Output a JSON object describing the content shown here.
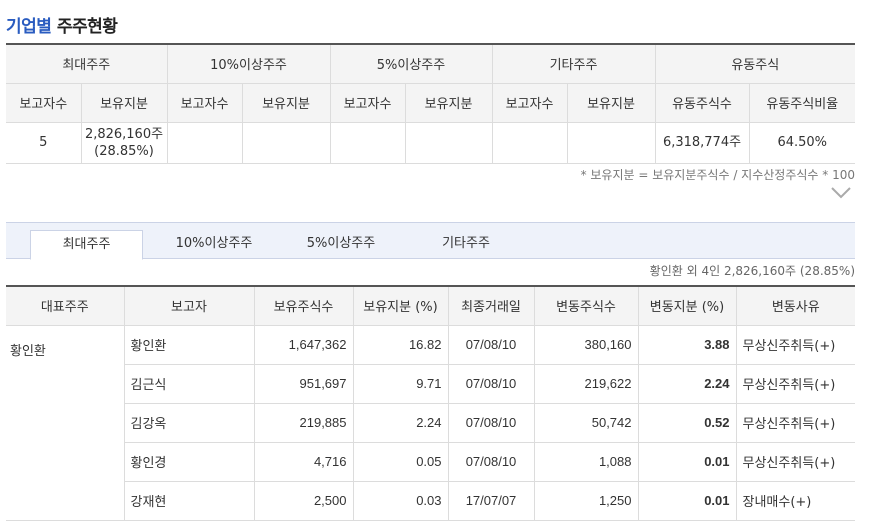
{
  "title": {
    "accent": "기업별",
    "rest": "주주현황"
  },
  "summary": {
    "groups": [
      "최대주주",
      "10%이상주주",
      "5%이상주주",
      "기타주주",
      "유동주식"
    ],
    "subheaders": [
      "보고자수",
      "보유지분",
      "보고자수",
      "보유지분",
      "보고자수",
      "보유지분",
      "보고자수",
      "보유지분",
      "유동주식수",
      "유동주식비율"
    ],
    "row": {
      "reporters": "5",
      "holding_line1": "2,826,160주",
      "holding_line2": "(28.85%)",
      "c3": "",
      "c4": "",
      "c5": "",
      "c6": "",
      "c7": "",
      "c8": "",
      "float_shares": "6,318,774주",
      "float_ratio": "64.50%"
    }
  },
  "footnote": "* 보유지분 = 보유지분주식수 / 지수산정주식수 * 100",
  "tabs": [
    "최대주주",
    "10%이상주주",
    "5%이상주주",
    "기타주주"
  ],
  "active_tab": 0,
  "owner_summary": "황인환 외 4인 2,826,160주 (28.85%)",
  "detail": {
    "headers": [
      "대표주주",
      "보고자",
      "보유주식수",
      "보유지분 (%)",
      "최종거래일",
      "변동주식수",
      "변동지분 (%)",
      "변동사유"
    ],
    "representative": "황인환",
    "rows": [
      {
        "reporter": "황인환",
        "shares": "1,647,362",
        "pct": "16.82",
        "date": "07/08/10",
        "change": "380,160",
        "change_pct": "3.88",
        "reason": "무상신주취득(+)"
      },
      {
        "reporter": "김근식",
        "shares": "951,697",
        "pct": "9.71",
        "date": "07/08/10",
        "change": "219,622",
        "change_pct": "2.24",
        "reason": "무상신주취득(+)"
      },
      {
        "reporter": "김강옥",
        "shares": "219,885",
        "pct": "2.24",
        "date": "07/08/10",
        "change": "50,742",
        "change_pct": "0.52",
        "reason": "무상신주취득(+)"
      },
      {
        "reporter": "황인경",
        "shares": "4,716",
        "pct": "0.05",
        "date": "07/08/10",
        "change": "1,088",
        "change_pct": "0.01",
        "reason": "무상신주취득(+)"
      },
      {
        "reporter": "강재현",
        "shares": "2,500",
        "pct": "0.03",
        "date": "17/07/07",
        "change": "1,250",
        "change_pct": "0.01",
        "reason": "장내매수(+)"
      }
    ]
  }
}
